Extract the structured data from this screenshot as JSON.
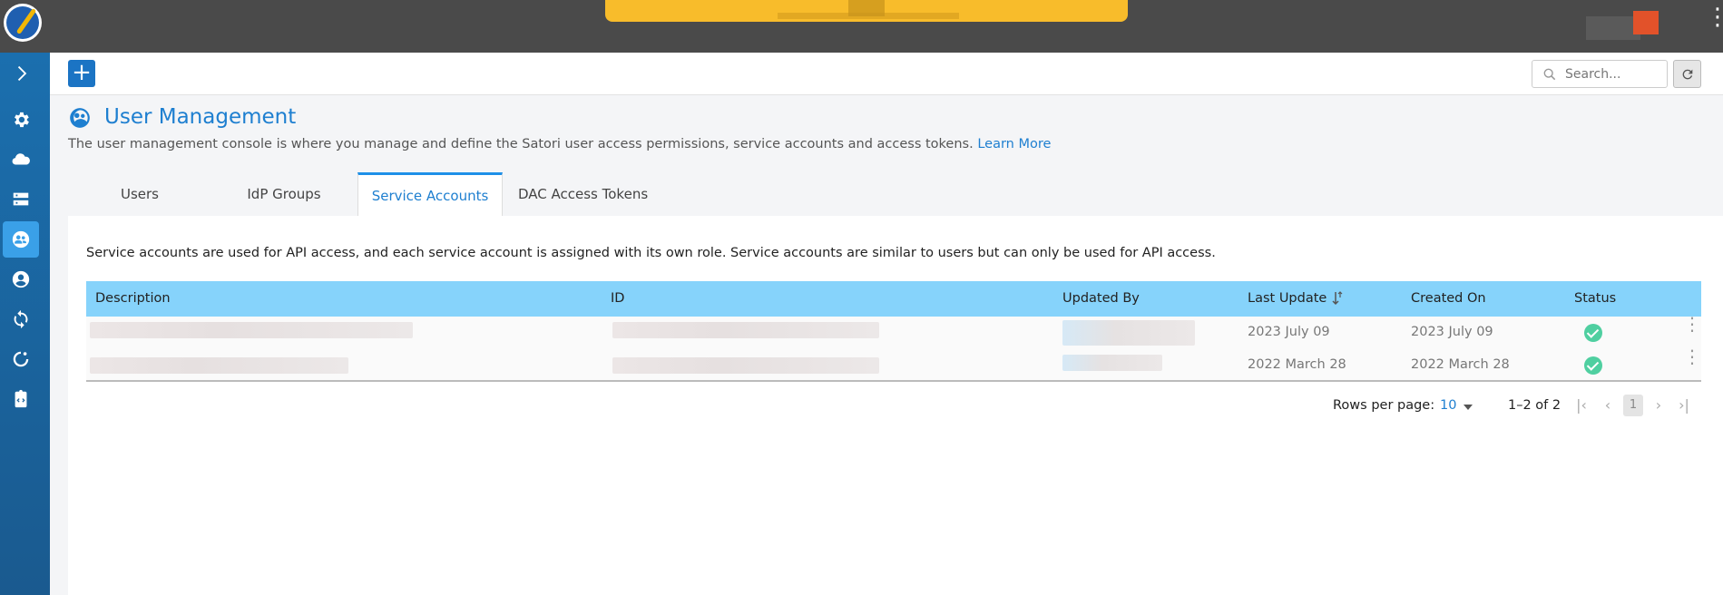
{
  "topbar": {},
  "toolbar": {
    "add_label": "+",
    "search_placeholder": "Search..."
  },
  "page": {
    "title": "User Management",
    "description": "The user management console is where you manage and define the Satori user access permissions, service accounts and access tokens.",
    "learn_more": "Learn More"
  },
  "tabs": [
    {
      "label": "Users",
      "active": false
    },
    {
      "label": "IdP Groups",
      "active": false
    },
    {
      "label": "Service Accounts",
      "active": true
    },
    {
      "label": "DAC Access Tokens",
      "active": false
    }
  ],
  "panel": {
    "description": "Service accounts are used for API access, and each service account is assigned with its own role. Service accounts are similar to users but can only be used for API access."
  },
  "table": {
    "columns": [
      "Description",
      "ID",
      "Updated By",
      "Last Update",
      "Created On",
      "Status"
    ],
    "rows": [
      {
        "last_update": "2023 July 09",
        "created_on": "2023 July 09",
        "status": "active"
      },
      {
        "last_update": "2022 March 28",
        "created_on": "2022 March 28",
        "status": "active"
      }
    ]
  },
  "pagination": {
    "rows_per_page_label": "Rows per page:",
    "rows_per_page": "10",
    "range": "1–2 of 2",
    "current_page": "1"
  },
  "colors": {
    "accent": "#1e7fd0",
    "header_bg": "#86d3fb",
    "sidebar": "#1b6fae",
    "status_ok": "#4fcfa0",
    "banner": "#f8bc2b"
  }
}
